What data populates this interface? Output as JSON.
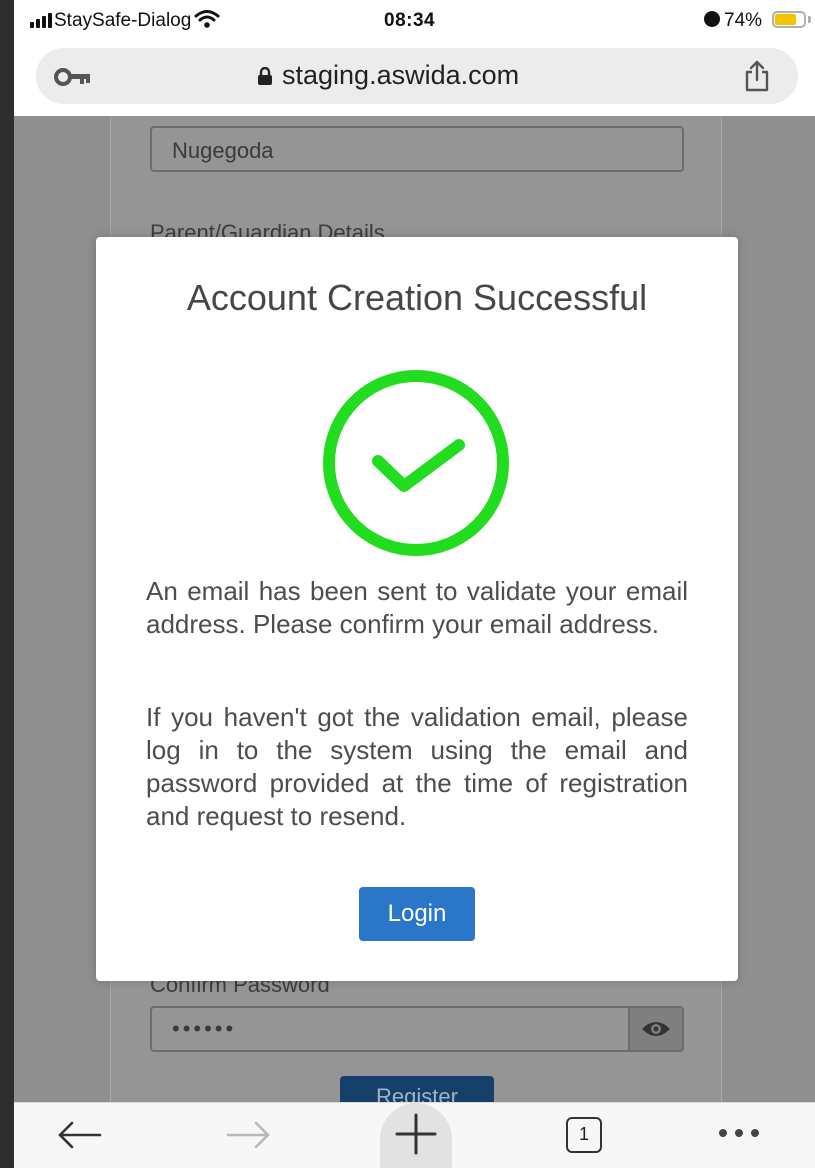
{
  "status_bar": {
    "carrier": "StaySafe-Dialog",
    "time": "08:34",
    "battery": "74%",
    "battery_level": 0.74
  },
  "browser": {
    "url": "staging.aswida.com"
  },
  "background_form": {
    "city_value": "Nugegoda",
    "section_heading": "Parent/Guardian Details",
    "confirm_password_label": "Confirm Password",
    "confirm_password_value": "••••••",
    "register_label": "Register"
  },
  "modal": {
    "title": "Account Creation Successful",
    "message_1": "An email has been sent to validate your email address. Please confirm your email address.",
    "message_2": "If you haven't got the validation email, please log in to the system using the email and password provided at the time of registration and request to resend.",
    "login_label": "Login",
    "success_color": "#22dd1f",
    "button_color": "#2a77c9"
  },
  "toolbar": {
    "tab_count": "1"
  }
}
